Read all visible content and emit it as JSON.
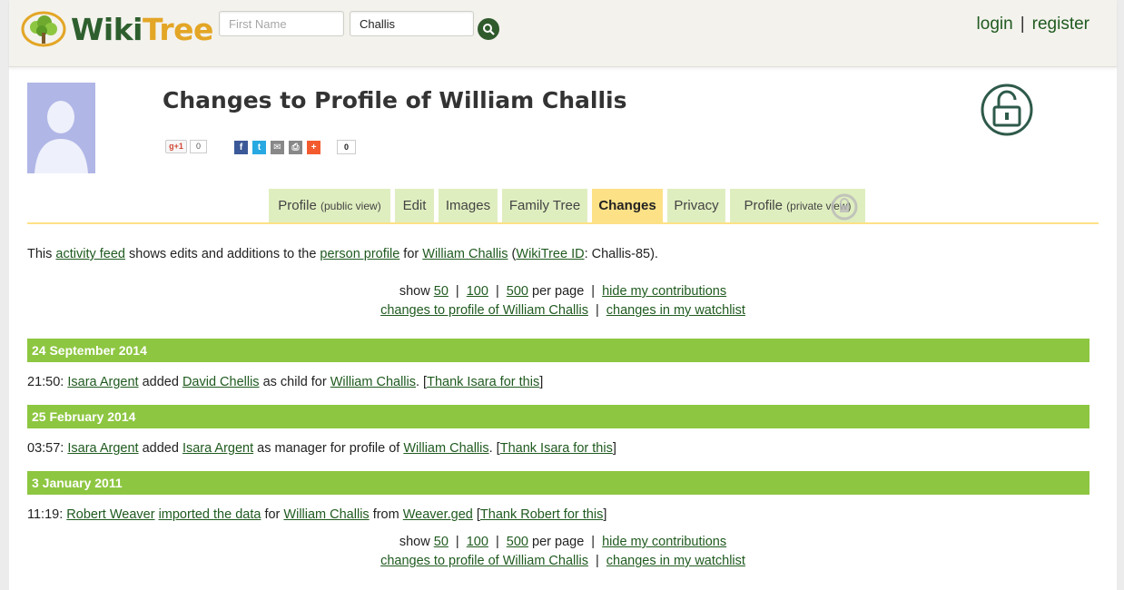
{
  "header": {
    "logo": {
      "word1": "Wiki",
      "word2": "Tree"
    },
    "search": {
      "first_placeholder": "First Name",
      "last_value": "Challis"
    },
    "auth": {
      "login": "login",
      "separator": "|",
      "register": "register"
    }
  },
  "profile": {
    "title": "Changes to Profile of William Challis",
    "gplus": {
      "label": "g+1",
      "count": "0"
    },
    "share_count": "0"
  },
  "tabs": [
    {
      "label": "Profile",
      "sub": "(public view)"
    },
    {
      "label": "Edit"
    },
    {
      "label": "Images"
    },
    {
      "label": "Family Tree"
    },
    {
      "label": "Changes"
    },
    {
      "label": "Privacy"
    },
    {
      "label": "Profile",
      "sub": "(private view)"
    }
  ],
  "intro": {
    "t1": "This ",
    "activity_feed": "activity feed",
    "t2": " shows edits and additions to the ",
    "person_profile": "person profile",
    "t3": " for ",
    "name": "William Challis",
    "t4": " (",
    "wikitree_id": "WikiTree ID",
    "t5": ": Challis-85)."
  },
  "pager": {
    "show": "show",
    "opt50": "50",
    "opt100": "100",
    "opt500": "500",
    "per_page": "per page",
    "sep": "|",
    "hide": "hide my contributions",
    "changes_to_profile": "changes to profile of William Challis",
    "watchlist": "changes in my watchlist"
  },
  "feed": [
    {
      "date": "24 September 2014",
      "time": "21:50:",
      "actor": "Isara Argent",
      "verb": " added ",
      "object": "David Chellis",
      "mid": " as child for ",
      "target": "William Challis",
      "sep": ". [",
      "thanks": "Thank Isara for this",
      "end": "]"
    },
    {
      "date": "25 February 2014",
      "time": "03:57:",
      "actor": "Isara Argent",
      "verb": " added ",
      "object": "Isara Argent",
      "mid": " as manager for profile of ",
      "target": "William Challis",
      "sep": ". [",
      "thanks": "Thank Isara for this",
      "end": "]"
    },
    {
      "date": "3 January 2011",
      "time": "11:19:",
      "actor": "Robert Weaver",
      "action_link": "imported the data",
      "t_for": " for ",
      "target": "William Challis",
      "t_from": " from ",
      "file": "Weaver.ged",
      "sep": " [",
      "thanks": "Thank Robert for this",
      "end": "]"
    }
  ],
  "colors": {
    "date_bar": "#8dc641",
    "tab": "#dfeebf",
    "tab_active": "#fde186",
    "link": "#1f5a1f"
  }
}
